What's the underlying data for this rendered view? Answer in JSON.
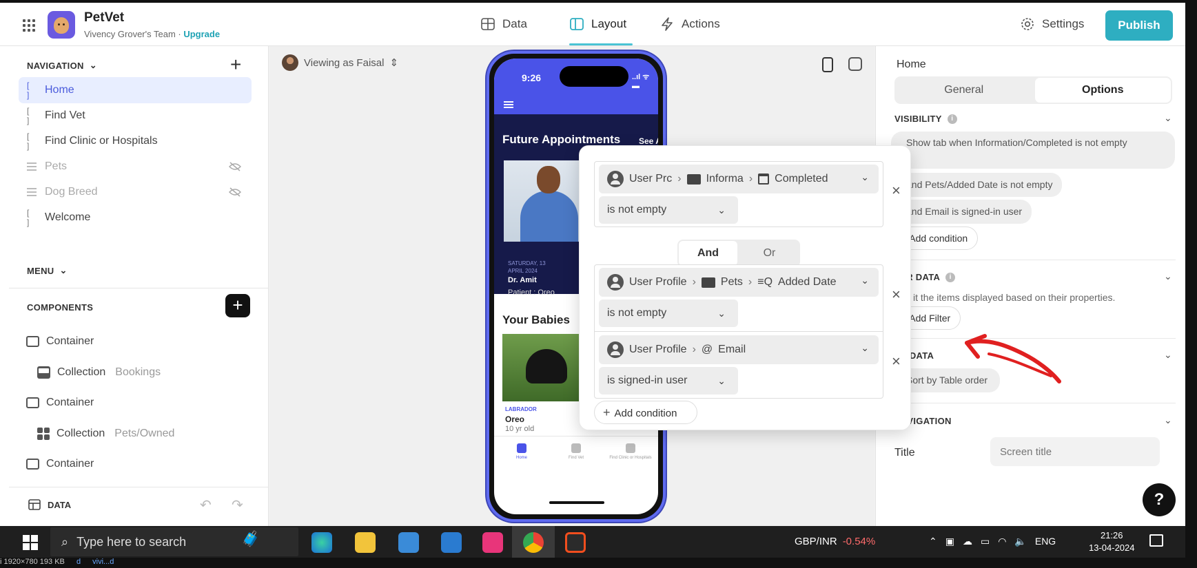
{
  "app": {
    "name": "PetVet",
    "team": "Vivency Grover's Team · ",
    "upgrade": "Upgrade",
    "logo_icon": "dog-face-icon"
  },
  "topnav": {
    "data": "Data",
    "layout": "Layout",
    "actions": "Actions",
    "settings": "Settings",
    "publish": "Publish"
  },
  "colors": {
    "accent": "#2eaec1",
    "phone_primary": "#4a53e8",
    "active_nav_bg": "#e8eeff",
    "annotation": "#e02020"
  },
  "sidebar": {
    "navigation_header": "NAVIGATION",
    "items": [
      {
        "label": "Home",
        "icon": "screen-icon"
      },
      {
        "label": "Find Vet",
        "icon": "screen-icon"
      },
      {
        "label": "Find Clinic or Hospitals",
        "icon": "screen-icon"
      },
      {
        "label": "Pets",
        "icon": "list-icon",
        "hidden": true
      },
      {
        "label": "Dog Breed",
        "icon": "list-icon",
        "hidden": true
      },
      {
        "label": "Welcome",
        "icon": "screen-icon"
      }
    ],
    "menu_header": "MENU",
    "components_header": "COMPONENTS",
    "components": [
      {
        "label": "Container",
        "sub": ""
      },
      {
        "label": "Collection",
        "sub": "Bookings"
      },
      {
        "label": "Container",
        "sub": ""
      },
      {
        "label": "Collection",
        "sub": "Pets/Owned"
      },
      {
        "label": "Container",
        "sub": ""
      }
    ],
    "data_label": "DATA"
  },
  "canvas": {
    "viewing_as": "Viewing as Faisal"
  },
  "phone": {
    "time": "9:26",
    "status": "..ıl ᯤ ▬",
    "future_title": "Future Appointments",
    "see_all": "See All ›",
    "date": "SATURDAY, 13 APRIL 2024",
    "doctor": "Dr. Amit",
    "patient": "Patient : Oreo",
    "babies_title": "Your Babies",
    "breed": "LABRADOR",
    "pet_name": "Oreo",
    "pet_age": "10 yr old",
    "tabs": [
      "Home",
      "Find Vet",
      "Find Clinic or Hospitals"
    ]
  },
  "filter_popup": {
    "conditions": [
      {
        "path": [
          "User Prc",
          "Informa",
          "Completed"
        ],
        "operator": "is not empty"
      },
      {
        "path": [
          "User Profile",
          "Pets",
          "Added Date"
        ],
        "operator": "is not empty"
      },
      {
        "path": [
          "User Profile",
          "Email"
        ],
        "operator": "is signed-in user"
      }
    ],
    "and_label": "And",
    "or_label": "Or",
    "add_condition": "Add condition"
  },
  "right_panel": {
    "screen_title": "Home",
    "tabs": [
      "General",
      "Options"
    ],
    "visibility_header": "VISIBILITY",
    "visibility_rules": [
      "Show tab when Information/Completed is not empty",
      "and Pets/Added Date is not empty",
      "and Email is signed-in user"
    ],
    "add_condition": "Add condition",
    "filter_header": "TER DATA",
    "filter_desc": "it the items displayed based on their properties.",
    "add_filter": "Add Filter",
    "sort_header": "RT DATA",
    "sort_chip": "Sort by Table order",
    "navigation_header": "NAVIGATION",
    "title_label": "Title",
    "title_placeholder": "Screen title"
  },
  "taskbar": {
    "search_placeholder": "Type here to search",
    "ticker": "GBP/INR",
    "ticker_change": "-0.54%",
    "language": "ENG",
    "time": "21:26",
    "date": "13-04-2024"
  },
  "status_strip": {
    "size": "i     1920×780  193 KB",
    "items": [
      "d",
      "vivi...d"
    ]
  }
}
